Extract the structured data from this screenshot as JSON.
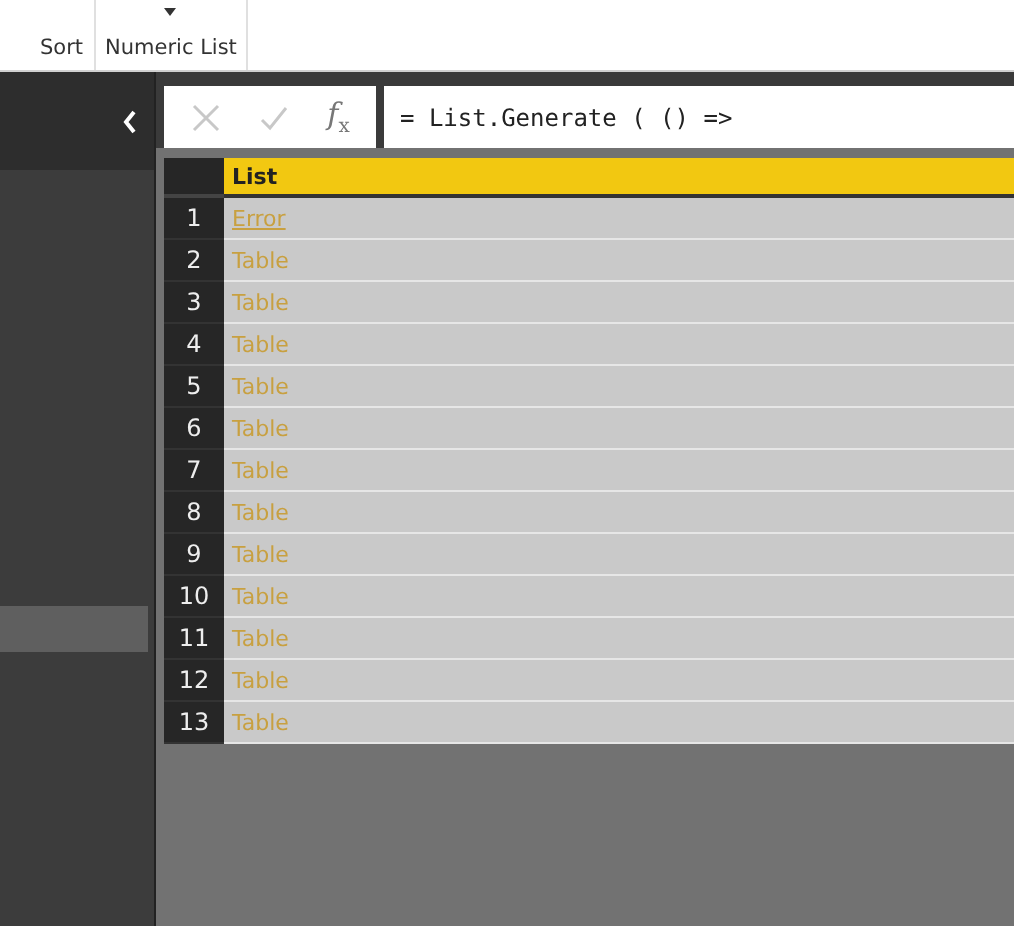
{
  "ribbon": {
    "groups": [
      {
        "label": "Sort",
        "dropdown": false
      },
      {
        "label": "Numeric List",
        "dropdown": true
      }
    ]
  },
  "sidebar": {
    "items": [
      {
        "selected": true
      }
    ]
  },
  "formula_bar": {
    "function_label": "*f*$_{x}$",
    "value": "= List.Generate ( () =>"
  },
  "table": {
    "columns": [
      "List"
    ],
    "rows": [
      {
        "num": "1",
        "value": "Error",
        "kind": "error"
      },
      {
        "num": "2",
        "value": "Table",
        "kind": "table"
      },
      {
        "num": "3",
        "value": "Table",
        "kind": "table"
      },
      {
        "num": "4",
        "value": "Table",
        "kind": "table"
      },
      {
        "num": "5",
        "value": "Table",
        "kind": "table"
      },
      {
        "num": "6",
        "value": "Table",
        "kind": "table"
      },
      {
        "num": "7",
        "value": "Table",
        "kind": "table"
      },
      {
        "num": "8",
        "value": "Table",
        "kind": "table"
      },
      {
        "num": "9",
        "value": "Table",
        "kind": "table"
      },
      {
        "num": "10",
        "value": "Table",
        "kind": "table"
      },
      {
        "num": "11",
        "value": "Table",
        "kind": "table"
      },
      {
        "num": "12",
        "value": "Table",
        "kind": "table"
      },
      {
        "num": "13",
        "value": "Table",
        "kind": "table"
      }
    ]
  }
}
